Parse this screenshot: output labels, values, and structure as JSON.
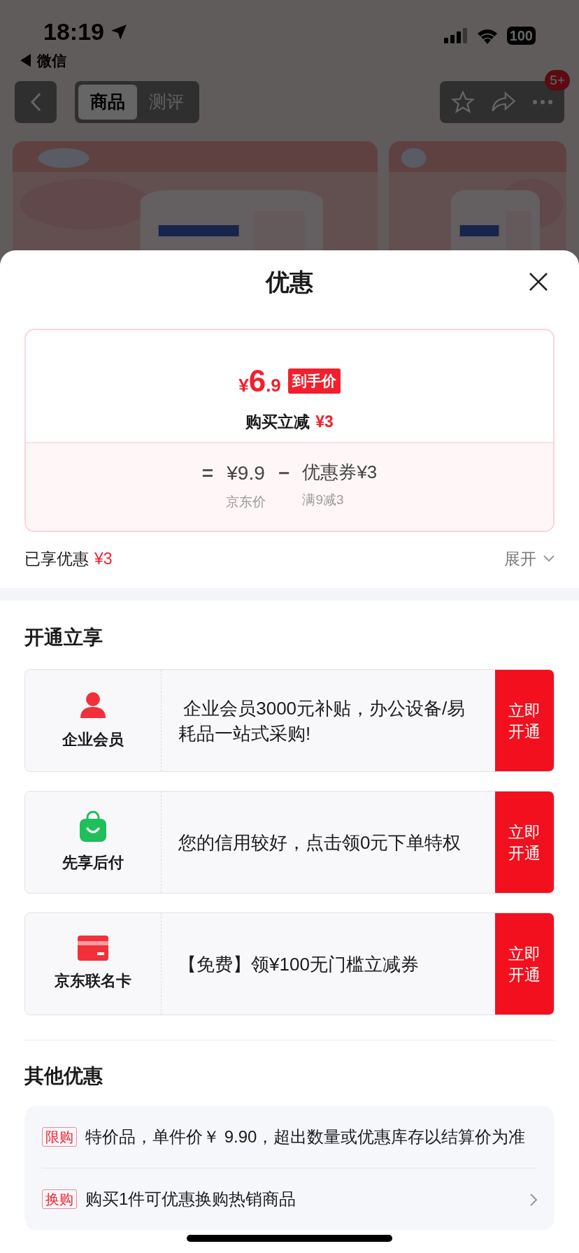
{
  "status_bar": {
    "time": "18:19",
    "back_app": "◀ 微信",
    "battery": "100"
  },
  "nav": {
    "tabs": [
      {
        "label": "商品",
        "selected": true
      },
      {
        "label": "测评",
        "selected": false
      }
    ],
    "badge": "5+"
  },
  "sheet": {
    "title": "优惠",
    "price_card": {
      "currency": "¥",
      "integer": "6",
      "decimal": ".9",
      "tag": "到手价",
      "discount_label": "购买立减",
      "discount_amount": "¥3",
      "equals": "=",
      "base_price": "¥9.9",
      "base_label": "京东价",
      "minus": "−",
      "coupon": "优惠券¥3",
      "coupon_rule": "满9减3"
    },
    "enjoyed": {
      "label": "已享优惠",
      "amount": "¥3",
      "expand": "展开"
    },
    "open_section": {
      "title": "开通立享",
      "items": [
        {
          "kind": "person",
          "name": "企业会员",
          "text": " 企业会员3000元补贴，办公设备/易耗品一站式采购!",
          "button": "立即开通"
        },
        {
          "kind": "bag",
          "name": "先享后付",
          "text": "您的信用较好，点击领0元下单特权",
          "button": "立即开通"
        },
        {
          "kind": "card",
          "name": "京东联名卡",
          "text": "【免费】领¥100无门槛立减券",
          "button": "立即开通"
        }
      ]
    },
    "other_section": {
      "title": "其他优惠",
      "items": [
        {
          "tag": "限购",
          "text": "特价品，单件价￥ 9.90，超出数量或优惠库存以结算价为准",
          "arrow": false
        },
        {
          "tag": "换购",
          "text": "购买1件可优惠换购热销商品",
          "arrow": true
        }
      ]
    }
  }
}
